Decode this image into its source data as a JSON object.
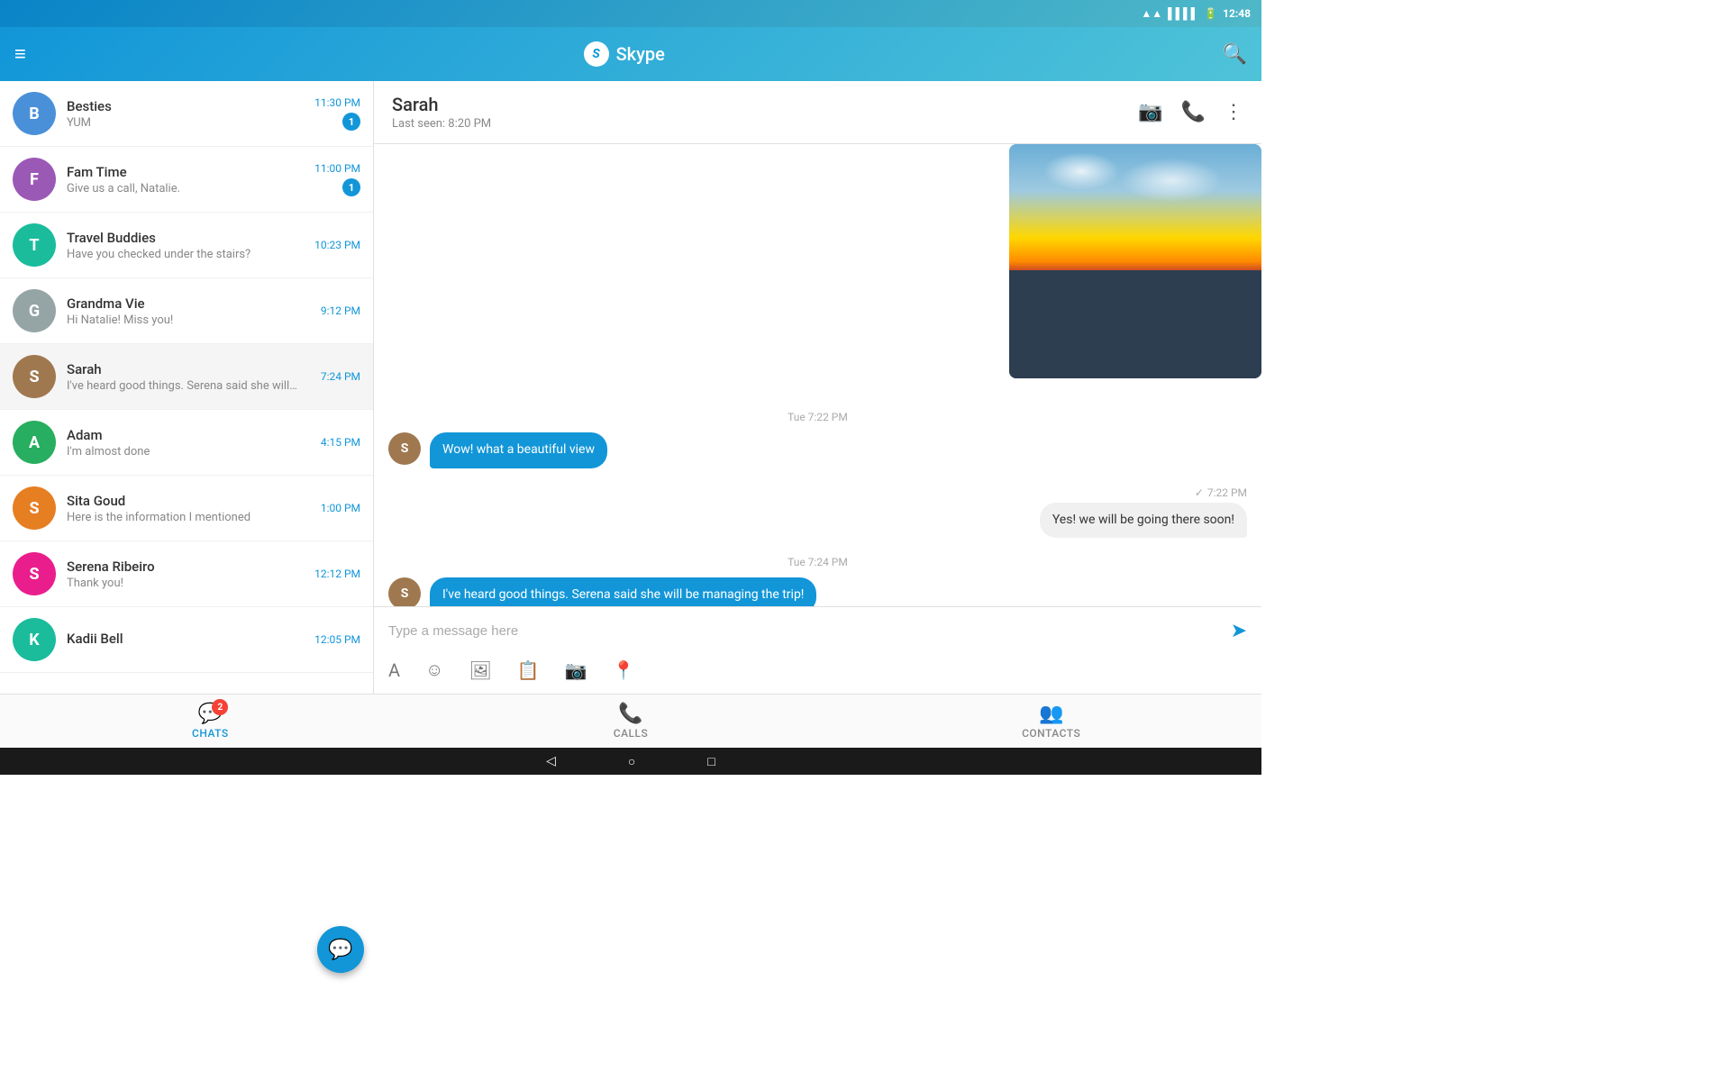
{
  "statusBar": {
    "time": "12:48",
    "icons": [
      "wifi",
      "signal",
      "battery"
    ]
  },
  "toolbar": {
    "menuIcon": "≡",
    "title": "Skype",
    "searchIcon": "🔍"
  },
  "sidebar": {
    "chats": [
      {
        "id": "besties",
        "name": "Besties",
        "preview": "YUM",
        "time": "11:30 PM",
        "badge": "1",
        "avatarColor": "av-blue",
        "avatarText": "B"
      },
      {
        "id": "fam-time",
        "name": "Fam Time",
        "preview": "Give us a call, Natalie.",
        "time": "11:00 PM",
        "badge": "1",
        "avatarColor": "av-purple",
        "avatarText": "F"
      },
      {
        "id": "travel-buddies",
        "name": "Travel Buddies",
        "preview": "Have you checked under the stairs?",
        "time": "10:23 PM",
        "badge": null,
        "avatarColor": "av-teal",
        "avatarText": "T"
      },
      {
        "id": "grandma-vie",
        "name": "Grandma Vie",
        "preview": "Hi Natalie! Miss you!",
        "time": "9:12 PM",
        "badge": null,
        "avatarColor": "av-gray",
        "avatarText": "G"
      },
      {
        "id": "sarah",
        "name": "Sarah",
        "preview": "I've heard good things. Serena said she will…",
        "time": "7:24 PM",
        "badge": null,
        "avatarColor": "av-brown",
        "avatarText": "S",
        "active": true
      },
      {
        "id": "adam",
        "name": "Adam",
        "preview": "I'm almost done",
        "time": "4:15 PM",
        "badge": null,
        "avatarColor": "av-green",
        "avatarText": "A"
      },
      {
        "id": "sita-goud",
        "name": "Sita Goud",
        "preview": "Here is the information I mentioned",
        "time": "1:00 PM",
        "badge": null,
        "avatarColor": "av-orange",
        "avatarText": "S"
      },
      {
        "id": "serena-ribeiro",
        "name": "Serena Ribeiro",
        "preview": "Thank you!",
        "time": "12:12 PM",
        "badge": null,
        "avatarColor": "av-pink",
        "avatarText": "S"
      },
      {
        "id": "kadii-bell",
        "name": "Kadii Bell",
        "preview": "",
        "time": "12:05 PM",
        "badge": null,
        "avatarColor": "av-teal",
        "avatarText": "K"
      }
    ]
  },
  "chatHeader": {
    "name": "Sarah",
    "status": "Last seen: 8:20 PM"
  },
  "messages": [
    {
      "id": "msg1",
      "type": "received",
      "timestamp": "Tue 7:22 PM",
      "text": "Wow! what a beautiful view",
      "avatarText": "S"
    },
    {
      "id": "msg2",
      "type": "sent",
      "timestamp": "7:22 PM",
      "text": "Yes! we will be going there soon!",
      "checks": "✓"
    },
    {
      "id": "msg3",
      "type": "received",
      "timestamp": "Tue 7:24 PM",
      "text": "I've heard good things. Serena said she will be managing the trip!",
      "avatarText": "S"
    }
  ],
  "inputPlaceholder": "Type a message here",
  "bottomNav": {
    "items": [
      {
        "id": "chats",
        "label": "CHATS",
        "icon": "💬",
        "badge": "2",
        "active": true
      },
      {
        "id": "calls",
        "label": "CALLS",
        "icon": "📞",
        "badge": null,
        "active": false
      },
      {
        "id": "contacts",
        "label": "CONTACTS",
        "icon": "👥",
        "badge": null,
        "active": false
      }
    ]
  },
  "androidNav": {
    "back": "◁",
    "home": "○",
    "recent": "□"
  }
}
